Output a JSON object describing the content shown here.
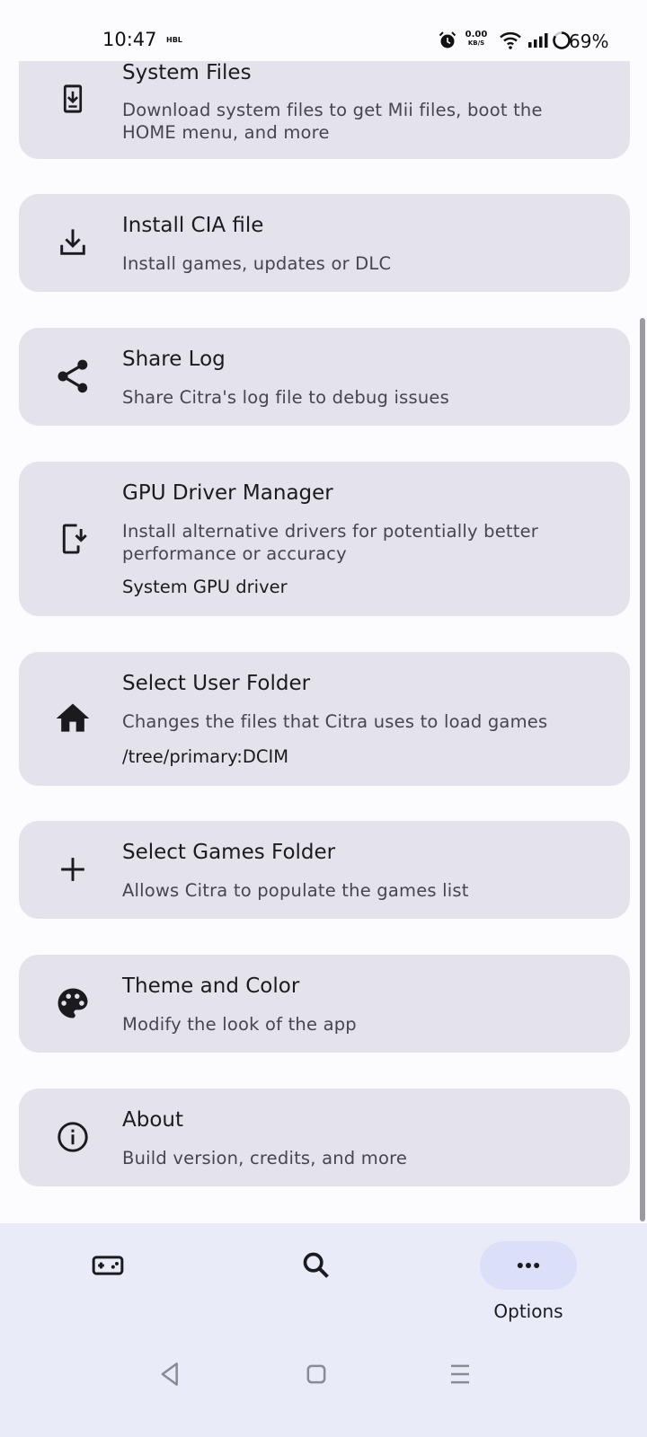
{
  "status_bar": {
    "time": "10:47",
    "carrier": "HBL",
    "net_speed_value": "0.00",
    "net_speed_unit": "KB/S",
    "battery": "69%"
  },
  "menu": {
    "items": [
      {
        "icon": "download-to-device-icon",
        "title": "System Files",
        "description": "Download system files to get Mii files, boot the HOME menu, and more"
      },
      {
        "icon": "install-download-icon",
        "title": "Install CIA file",
        "description": "Install games, updates or DLC"
      },
      {
        "icon": "share-icon",
        "title": "Share Log",
        "description": "Share Citra's log file to debug issues"
      },
      {
        "icon": "phone-download-icon",
        "title": "GPU Driver Manager",
        "description": "Install alternative drivers for potentially better performance or accuracy",
        "value": "System GPU driver"
      },
      {
        "icon": "home-icon",
        "title": "Select User Folder",
        "description": "Changes the files that Citra uses to load games",
        "value": "/tree/primary:DCIM"
      },
      {
        "icon": "plus-icon",
        "title": "Select Games Folder",
        "description": "Allows Citra to populate the games list"
      },
      {
        "icon": "palette-icon",
        "title": "Theme and Color",
        "description": "Modify the look of the app"
      },
      {
        "icon": "info-icon",
        "title": "About",
        "description": "Build version, credits, and more"
      }
    ]
  },
  "bottom_nav": {
    "games_icon": "gamepad-icon",
    "search_icon": "search-icon",
    "options_icon": "more-horiz-icon",
    "options_label": "Options",
    "active": "options"
  },
  "system_nav": {
    "back_icon": "back-icon",
    "home_icon": "home-square-icon",
    "recents_icon": "recents-icon"
  },
  "colors": {
    "background": "#fcfbfe",
    "card": "#e4e2ea",
    "nav_bar": "#e9ebf8",
    "nav_active_pill": "#dcdff8"
  }
}
